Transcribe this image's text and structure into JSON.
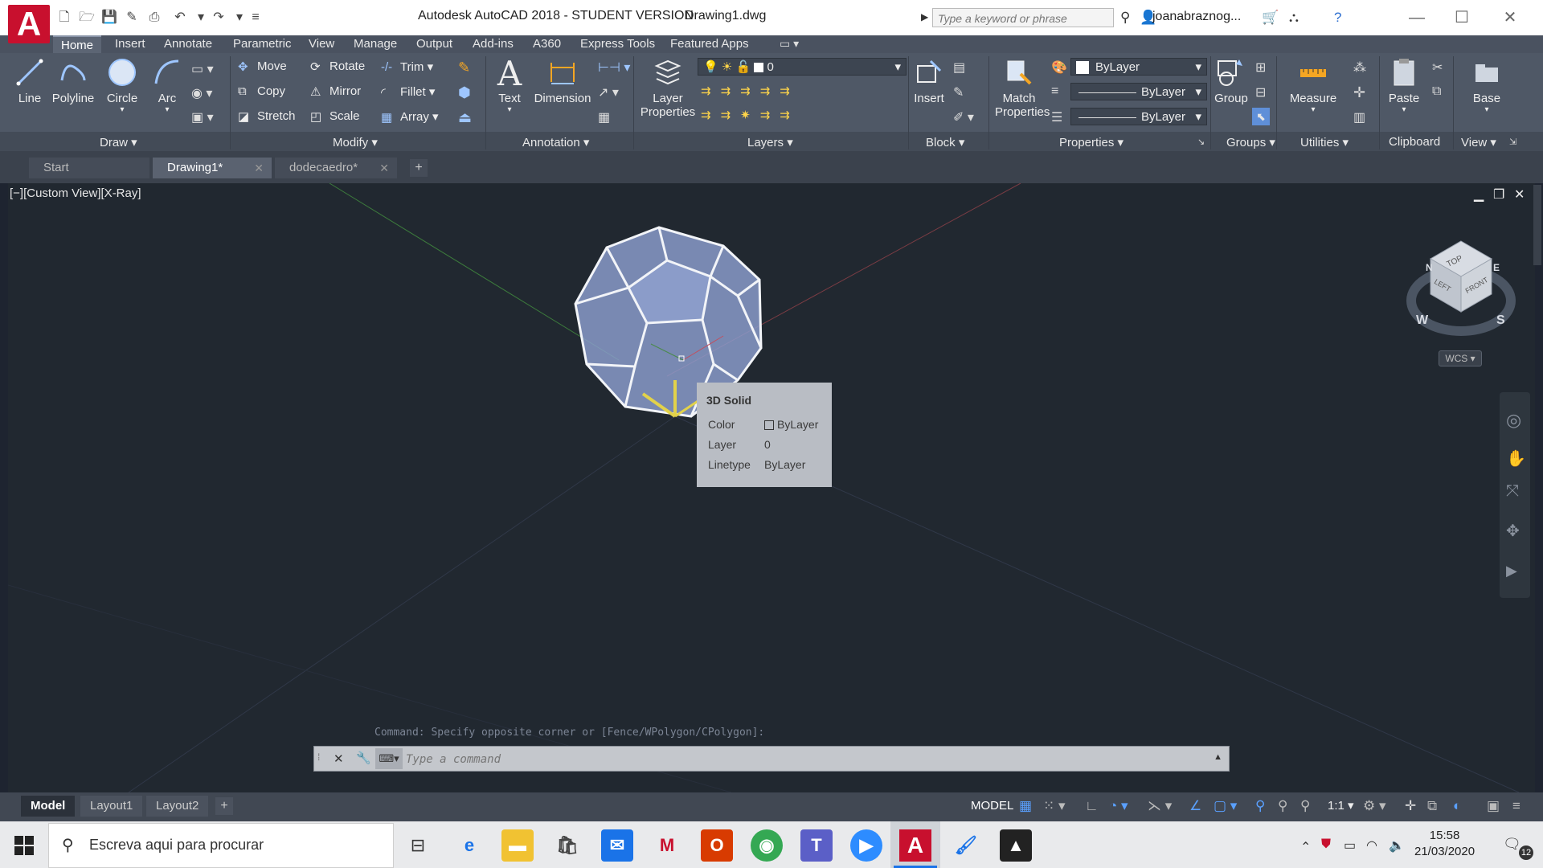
{
  "titlebar": {
    "app_title": "Autodesk AutoCAD 2018 - STUDENT VERSION",
    "file_name": "Drawing1.dwg",
    "search_placeholder": "Type a keyword or phrase",
    "user": "joanabraznog...",
    "logo_letter": "A"
  },
  "ribbon_tabs": [
    "Home",
    "Insert",
    "Annotate",
    "Parametric",
    "View",
    "Manage",
    "Output",
    "Add-ins",
    "A360",
    "Express Tools",
    "Featured Apps"
  ],
  "draw": {
    "line": "Line",
    "polyline": "Polyline",
    "circle": "Circle",
    "arc": "Arc",
    "title": "Draw"
  },
  "modify": {
    "move": "Move",
    "rotate": "Rotate",
    "trim": "Trim",
    "copy": "Copy",
    "mirror": "Mirror",
    "fillet": "Fillet",
    "stretch": "Stretch",
    "scale": "Scale",
    "array": "Array",
    "title": "Modify"
  },
  "annotation": {
    "text": "Text",
    "dimension": "Dimension",
    "title": "Annotation"
  },
  "layers": {
    "layer_properties_1": "Layer",
    "layer_properties_2": "Properties",
    "current_layer": "0",
    "title": "Layers"
  },
  "block": {
    "insert": "Insert",
    "title": "Block"
  },
  "properties": {
    "match_1": "Match",
    "match_2": "Properties",
    "color": "ByLayer",
    "linetype": "ByLayer",
    "lineweight": "ByLayer",
    "title": "Properties"
  },
  "groups": {
    "group": "Group",
    "title": "Groups"
  },
  "utilities": {
    "measure": "Measure",
    "title": "Utilities"
  },
  "clipboard": {
    "paste": "Paste",
    "title": "Clipboard"
  },
  "view": {
    "base": "Base",
    "title": "View"
  },
  "file_tabs": [
    {
      "label": "Start"
    },
    {
      "label": "Drawing1*"
    },
    {
      "label": "dodecaedro*"
    }
  ],
  "viewport": {
    "label": "[−][Custom View][X-Ray]"
  },
  "viewcube": {
    "top": "TOP",
    "left": "LEFT",
    "front": "FRONT",
    "compass_w": "W",
    "compass_s": "S",
    "compass_n": "N",
    "compass_e": "E",
    "wcs": "WCS"
  },
  "tooltip": {
    "title": "3D Solid",
    "color_label": "Color",
    "color_value": "ByLayer",
    "layer_label": "Layer",
    "layer_value": "0",
    "linetype_label": "Linetype",
    "linetype_value": "ByLayer"
  },
  "command": {
    "history": "Command: Specify opposite corner or [Fence/WPolygon/CPolygon]:",
    "placeholder": "Type a command"
  },
  "layout_tabs": [
    "Model",
    "Layout1",
    "Layout2"
  ],
  "status": {
    "model": "MODEL",
    "scale": "1:1"
  },
  "taskbar": {
    "search_text": "Escreva aqui para procurar",
    "time": "15:58",
    "date": "21/03/2020",
    "notifications": "12"
  },
  "colors": {
    "accent_red": "#c8102e",
    "ribbon_bg": "#4f5866",
    "viewport_bg": "#212830",
    "solid_fill": "#8c9fd0"
  }
}
